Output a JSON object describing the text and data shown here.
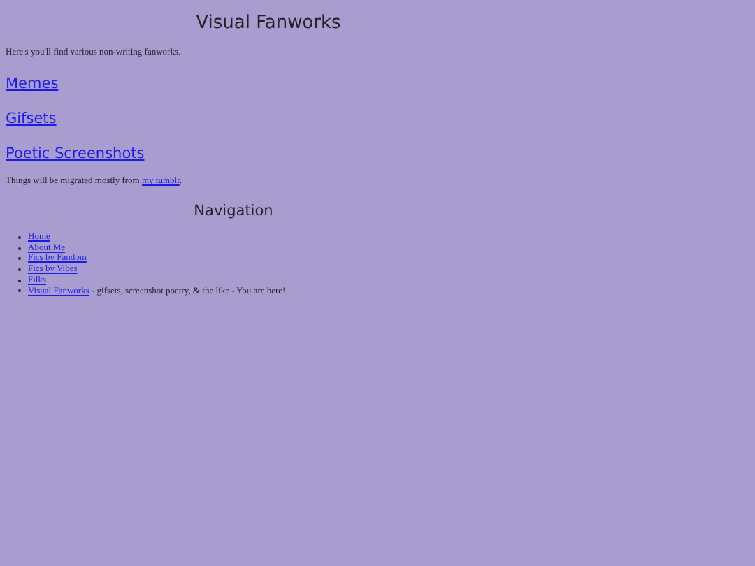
{
  "title": "Visual Fanworks",
  "intro": "Here's you'll find various non-writing fanworks.",
  "sections": [
    "Memes",
    "Gifsets",
    "Poetic Screenshots"
  ],
  "migration": {
    "before": "Things will be migrated mostly from ",
    "link": "my tumblr",
    "after": "."
  },
  "navigation": {
    "heading": "Navigation",
    "items": [
      {
        "label": "Home"
      },
      {
        "label": "About Me"
      },
      {
        "label": "Fics by Fandom"
      },
      {
        "label": "Fics by Vibes"
      },
      {
        "label": "Filks"
      },
      {
        "label": "Visual Fanworks",
        "note": " - gifsets, screenshot poetry, & the like - You are here!"
      }
    ]
  }
}
